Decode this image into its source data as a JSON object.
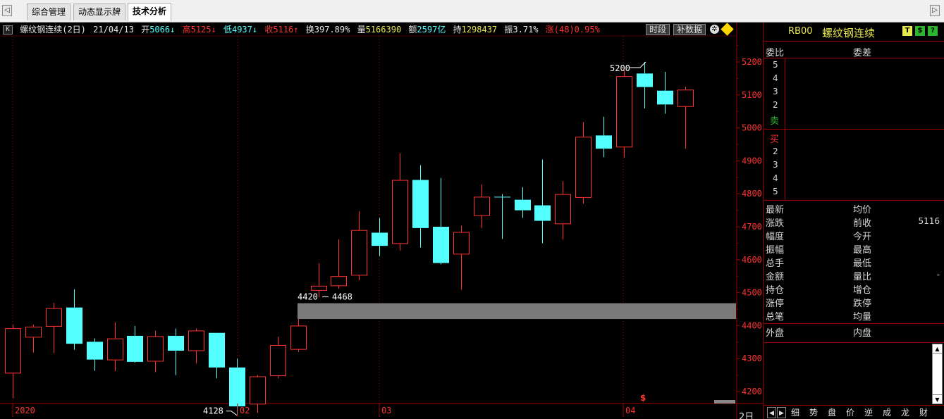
{
  "tabs": {
    "nav_left": "◁",
    "nav_right": "▷",
    "items": [
      "综合管理",
      "动态显示牌",
      "技术分析"
    ],
    "active": "技术分析"
  },
  "chart": {
    "k_icon": "K",
    "title": "螺纹钢连续(2日)",
    "date": "21/04/13",
    "open_label": "开",
    "open": "5066",
    "high_label": "高",
    "high": "5125",
    "low_label": "低",
    "low": "4937",
    "close_label": "收",
    "close": "5116",
    "turnover_label": "换",
    "turnover": "397.89%",
    "volume_label": "量",
    "volume": "5166390",
    "amount_label": "额",
    "amount": "2597亿",
    "oi_label": "持",
    "oi": "1298437",
    "amp_label": "振",
    "amp": "3.71%",
    "chg_label": "涨",
    "chg": "(48)0.95%",
    "btn_time": "时段",
    "btn_fill": "补数据",
    "period_label": "2日",
    "price_axis": [
      "5200",
      "5100",
      "5000",
      "4900",
      "4800",
      "4700",
      "4600",
      "4500",
      "4400",
      "4300",
      "4200"
    ],
    "date_axis": [
      "2020",
      "02",
      "03",
      "04"
    ],
    "annotations": {
      "max": "5200",
      "min": "4128",
      "gap_low": "4420",
      "gap_high": "4468",
      "marker": "$"
    },
    "colors": {
      "up": "#ff3232",
      "down": "#54ffff",
      "axis": "#a00000",
      "gap": "#7a7a7a"
    }
  },
  "chart_data": {
    "type": "candlestick",
    "title": "螺纹钢连续(2日)",
    "ylim": [
      4100,
      5250
    ],
    "candles": [
      {
        "o": 4257,
        "h": 4403,
        "l": 4180,
        "c": 4392
      },
      {
        "o": 4366,
        "h": 4403,
        "l": 4318,
        "c": 4397
      },
      {
        "o": 4399,
        "h": 4469,
        "l": 4317,
        "c": 4453
      },
      {
        "o": 4455,
        "h": 4510,
        "l": 4327,
        "c": 4345
      },
      {
        "o": 4351,
        "h": 4361,
        "l": 4263,
        "c": 4297
      },
      {
        "o": 4297,
        "h": 4410,
        "l": 4262,
        "c": 4361
      },
      {
        "o": 4369,
        "h": 4399,
        "l": 4288,
        "c": 4290
      },
      {
        "o": 4293,
        "h": 4385,
        "l": 4259,
        "c": 4368
      },
      {
        "o": 4369,
        "h": 4391,
        "l": 4250,
        "c": 4324
      },
      {
        "o": 4325,
        "h": 4391,
        "l": 4285,
        "c": 4385
      },
      {
        "o": 4378,
        "h": 4378,
        "l": 4240,
        "c": 4273
      },
      {
        "o": 4273,
        "h": 4300,
        "l": 4128,
        "c": 4155
      },
      {
        "o": 4163,
        "h": 4250,
        "l": 4135,
        "c": 4246
      },
      {
        "o": 4249,
        "h": 4366,
        "l": 4240,
        "c": 4341
      },
      {
        "o": 4329,
        "h": 4420,
        "l": 4320,
        "c": 4400
      },
      {
        "o": 4508,
        "h": 4590,
        "l": 4486,
        "c": 4521
      },
      {
        "o": 4522,
        "h": 4662,
        "l": 4512,
        "c": 4550
      },
      {
        "o": 4554,
        "h": 4747,
        "l": 4538,
        "c": 4690
      },
      {
        "o": 4682,
        "h": 4727,
        "l": 4611,
        "c": 4642
      },
      {
        "o": 4650,
        "h": 4923,
        "l": 4628,
        "c": 4842
      },
      {
        "o": 4842,
        "h": 4887,
        "l": 4637,
        "c": 4696
      },
      {
        "o": 4700,
        "h": 4848,
        "l": 4586,
        "c": 4590
      },
      {
        "o": 4618,
        "h": 4703,
        "l": 4509,
        "c": 4684
      },
      {
        "o": 4735,
        "h": 4829,
        "l": 4696,
        "c": 4791
      },
      {
        "o": 4791,
        "h": 4799,
        "l": 4663,
        "c": 4789
      },
      {
        "o": 4782,
        "h": 4820,
        "l": 4727,
        "c": 4750
      },
      {
        "o": 4765,
        "h": 4904,
        "l": 4650,
        "c": 4718
      },
      {
        "o": 4710,
        "h": 4839,
        "l": 4661,
        "c": 4799
      },
      {
        "o": 4790,
        "h": 5018,
        "l": 4770,
        "c": 4973
      },
      {
        "o": 4977,
        "h": 5034,
        "l": 4911,
        "c": 4937
      },
      {
        "o": 4943,
        "h": 5175,
        "l": 4910,
        "c": 5157
      },
      {
        "o": 5165,
        "h": 5200,
        "l": 5059,
        "c": 5124
      },
      {
        "o": 5113,
        "h": 5170,
        "l": 5043,
        "c": 5071
      },
      {
        "o": 5066,
        "h": 5125,
        "l": 4937,
        "c": 5116
      }
    ]
  },
  "panel": {
    "code": "RB00",
    "name": "螺纹钢连续",
    "flags": [
      "T",
      "$",
      "?"
    ],
    "header_left": "委比",
    "header_right": "委差",
    "sell_levels": [
      "5",
      "4",
      "3",
      "2"
    ],
    "sell_label": "卖",
    "buy_label": "买",
    "buy_levels": [
      "2",
      "3",
      "4",
      "5"
    ],
    "stats": [
      [
        "最新",
        "均价",
        ""
      ],
      [
        "涨跌",
        "前收",
        "5116"
      ],
      [
        "幅度",
        "今开",
        ""
      ],
      [
        "振幅",
        "最高",
        ""
      ],
      [
        "总手",
        "最低",
        ""
      ],
      [
        "金额",
        "量比",
        "-"
      ],
      [
        "持仓",
        "增仓",
        ""
      ],
      [
        "涨停",
        "跌停",
        ""
      ],
      [
        "总笔",
        "均量",
        ""
      ]
    ],
    "outer": "外盘",
    "inner": "内盘",
    "bottom_tabs": [
      "细",
      "势",
      "盘",
      "价",
      "逆",
      "成",
      "龙",
      "财"
    ],
    "bottom_nav": [
      "◀",
      "▶"
    ]
  }
}
